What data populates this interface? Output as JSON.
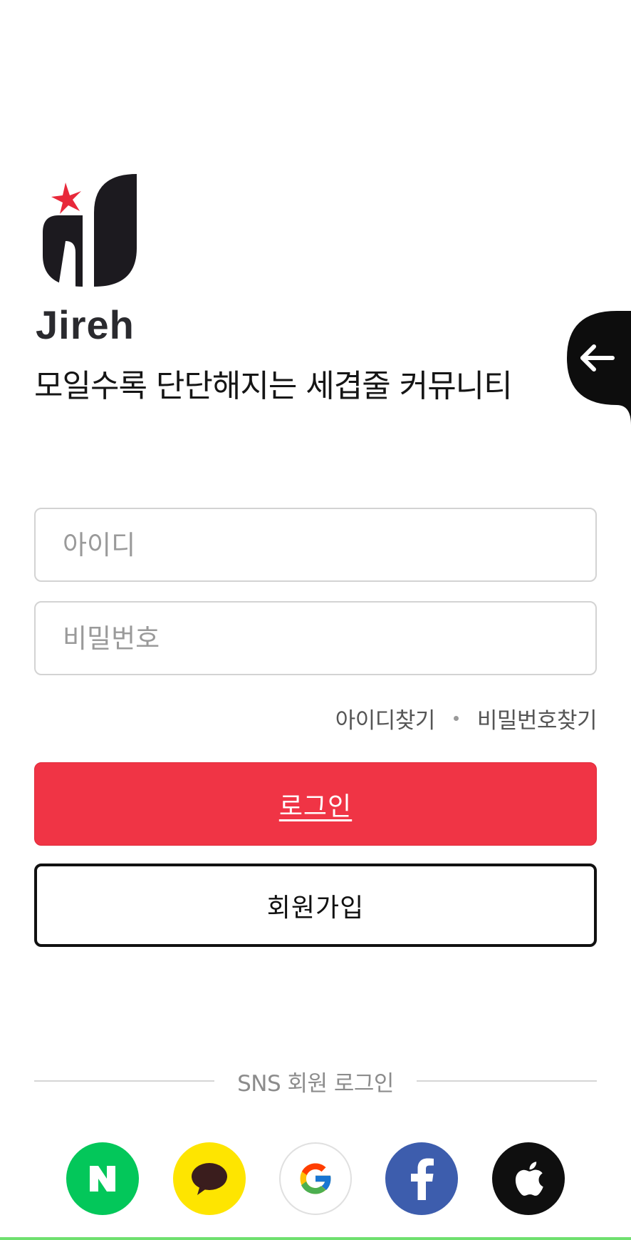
{
  "brand": {
    "name": "Jireh",
    "tagline": "모일수록 단단해지는 세겹줄 커뮤니티"
  },
  "login_form": {
    "id_placeholder": "아이디",
    "password_placeholder": "비밀번호",
    "find_id_label": "아이디찾기",
    "find_password_label": "비밀번호찾기",
    "login_label": "로그인",
    "signup_label": "회원가입"
  },
  "sns": {
    "divider_label": "SNS 회원 로그인",
    "providers": [
      {
        "name": "naver",
        "icon": "naver-icon",
        "color": "#03c75a"
      },
      {
        "name": "kakao",
        "icon": "kakao-icon",
        "color": "#fee500"
      },
      {
        "name": "google",
        "icon": "google-icon",
        "color": "#ffffff"
      },
      {
        "name": "facebook",
        "icon": "facebook-icon",
        "color": "#3d5dad"
      },
      {
        "name": "apple",
        "icon": "apple-icon",
        "color": "#0f0f0f"
      }
    ]
  },
  "colors": {
    "accent": "#f03445",
    "text": "#151515",
    "border": "#d3d3d3"
  },
  "back_tab": {
    "icon": "arrow-left-icon"
  }
}
